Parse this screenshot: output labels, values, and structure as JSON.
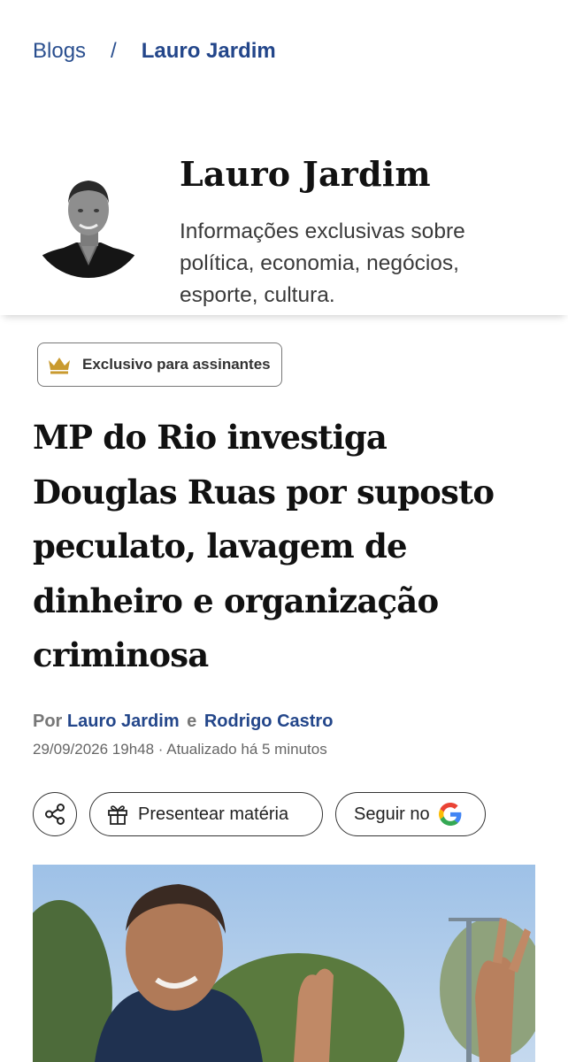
{
  "breadcrumb": {
    "parent": "Blogs",
    "separator": "/",
    "current": "Lauro Jardim"
  },
  "author_card": {
    "name": "Lauro Jardim",
    "description": "Informações exclusivas sobre política, economia, negócios, esporte, cultura."
  },
  "badge": {
    "icon": "crown-icon",
    "label": "Exclusivo para assinantes",
    "icon_color": "#c99a2e"
  },
  "article": {
    "headline": "MP do Rio investiga Douglas Ruas por suposto peculato, lavagem de dinheiro e organização criminosa",
    "byline": {
      "prefix": "Por",
      "author1": "Lauro Jardim",
      "conjunction": "e",
      "author2": "Rodrigo Castro"
    },
    "dateline": "29/09/2026 19h48 · Atualizado há 5 minutos"
  },
  "actions": {
    "share_icon": "share-icon",
    "gift_label": "Presentear matéria",
    "follow_label": "Seguir no",
    "follow_icon": "google-icon"
  },
  "colors": {
    "link_blue": "#23468a",
    "text": "#111111",
    "muted": "#777777"
  }
}
